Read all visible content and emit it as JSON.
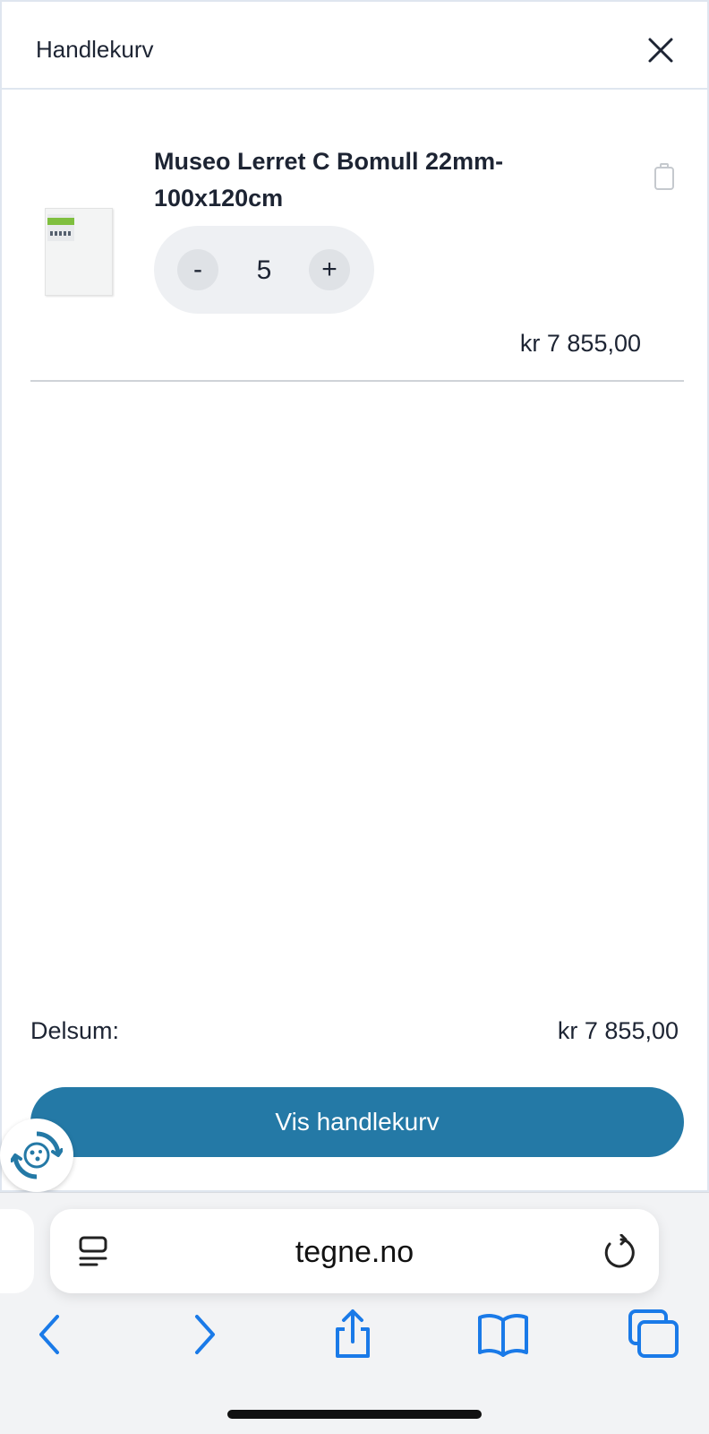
{
  "cart": {
    "title": "Handlekurv",
    "items": [
      {
        "name_line1": "Museo Lerret C Bomull 22mm-",
        "name_line2": "100x120cm",
        "quantity": "5",
        "decrease_label": "-",
        "increase_label": "+",
        "price": "kr 7 855,00"
      }
    ],
    "subtotal_label": "Delsum:",
    "subtotal_value": "kr 7 855,00",
    "checkout_label": "Vis handlekurv"
  },
  "browser": {
    "url": "tegne.no"
  },
  "colors": {
    "accent": "#2479a6",
    "text": "#1d2433",
    "ios_blue": "#1a7ae8"
  },
  "icons": [
    "close-icon",
    "trash-icon",
    "support-icon",
    "reader-icon",
    "reload-icon",
    "back-icon",
    "forward-icon",
    "share-icon",
    "bookmarks-icon",
    "tabs-icon"
  ]
}
